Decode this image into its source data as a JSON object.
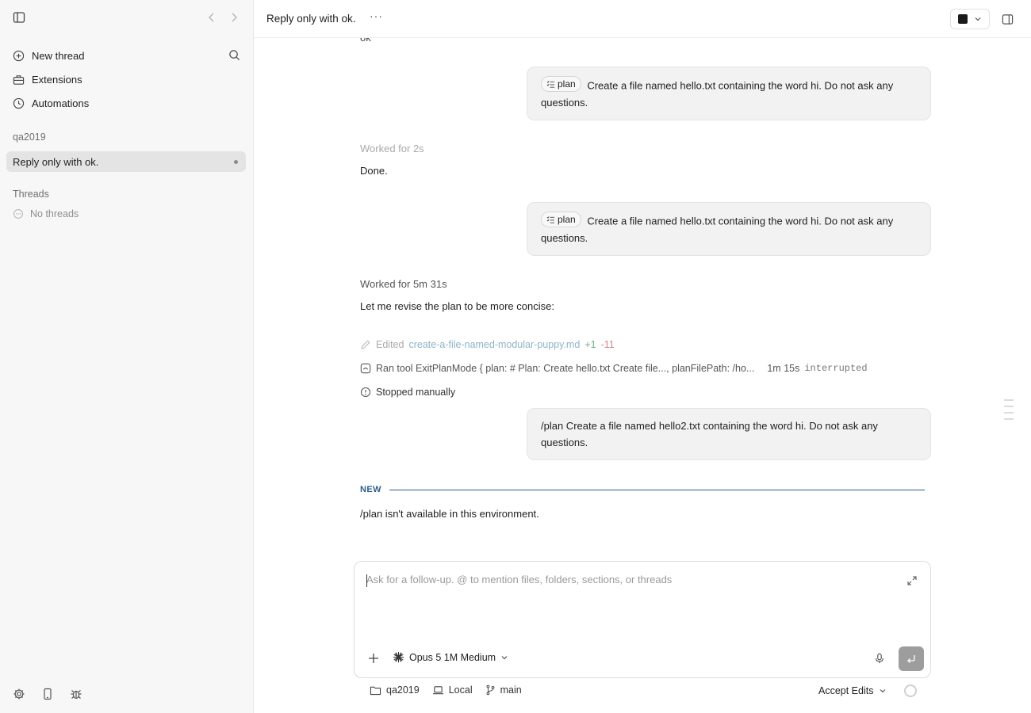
{
  "sidebar": {
    "menu": [
      {
        "label": "New thread",
        "icon": "plus-circle-icon"
      },
      {
        "label": "Extensions",
        "icon": "toolbox-icon"
      },
      {
        "label": "Automations",
        "icon": "clock-icon"
      }
    ],
    "project": "qa2019",
    "active_thread": "Reply only with ok.",
    "threads_label": "Threads",
    "no_threads": "No threads"
  },
  "header": {
    "title": "Reply only with ok.",
    "more": "···"
  },
  "chat": {
    "cut_text": "ok",
    "bubble1": {
      "chip": "plan",
      "text": "Create a file named hello.txt containing the word hi. Do not ask any questions."
    },
    "worked1": "Worked for 2s",
    "reply1": "Done.",
    "bubble2": {
      "chip": "plan",
      "text": "Create a file named hello.txt containing the word hi. Do not ask any questions."
    },
    "worked2": "Worked for 5m 31s",
    "reply2": "Let me revise the plan to be more concise:",
    "edited": {
      "prefix": "Edited",
      "file": "create-a-file-named-modular-puppy.md",
      "added": "+1",
      "removed": "-11"
    },
    "ran_tool": {
      "text": "Ran tool ExitPlanMode { plan: # Plan: Create hello.txt Create file..., planFilePath: /ho...",
      "duration": "1m 15s",
      "status": "interrupted"
    },
    "stopped": "Stopped manually",
    "bubble3": {
      "text": "/plan Create a file named hello2.txt containing the word hi. Do not ask any questions."
    },
    "new_label": "NEW",
    "reply3": "/plan isn't available in this environment."
  },
  "composer": {
    "placeholder": "Ask for a follow-up. @ to mention files, folders, sections, or threads",
    "model": "Opus 5 1M Medium"
  },
  "status": {
    "folder": "qa2019",
    "location": "Local",
    "branch": "main",
    "mode": "Accept Edits"
  },
  "colors": {
    "accent_new": "#2d5e88",
    "link": "#8fb3c9",
    "added": "#6fb08a",
    "removed": "#d58585"
  }
}
